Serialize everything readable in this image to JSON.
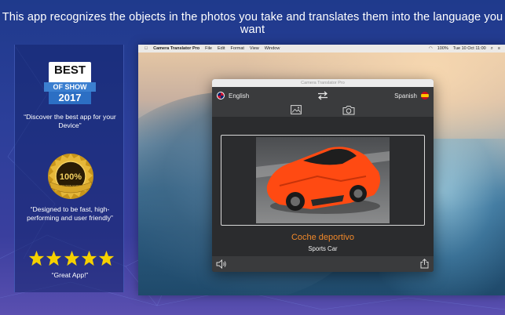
{
  "headline": "This app recognizes the objects in the photos you take and translates them into the language you want",
  "left_panel": {
    "badge": {
      "line1": "BEST",
      "ribbon": "OF SHOW",
      "year": "2017"
    },
    "quote1": "“Discover the best app for your Device”",
    "seal": {
      "text": "100%",
      "small": "SATISFACTION GUARANTEE"
    },
    "quote2": "“Designed to be fast, high-performing and user friendly”",
    "stars": 5,
    "quote3": "“Great App!”",
    "colors": {
      "star": "#f5d000",
      "gold": "#d4a017"
    }
  },
  "menubar": {
    "app_name": "Camera Translator Pro",
    "items": [
      "File",
      "Edit",
      "Format",
      "View",
      "Window"
    ],
    "battery": "100%",
    "clock": "Tue 10 Oct 11:00"
  },
  "window": {
    "title": "Camera Translator Pro",
    "source_lang": "English",
    "target_lang": "Spanish",
    "icons": {
      "source_flag": "uk-flag-icon",
      "target_flag": "spain-flag-icon",
      "swap": "swap-arrows-icon",
      "gallery": "image-icon",
      "camera": "camera-icon",
      "speaker": "speaker-icon",
      "share": "share-icon"
    },
    "translation": "Coche deportivo",
    "original": "Sports Car",
    "colors": {
      "translation": "#f0882a",
      "car": "#ff4a12"
    }
  }
}
